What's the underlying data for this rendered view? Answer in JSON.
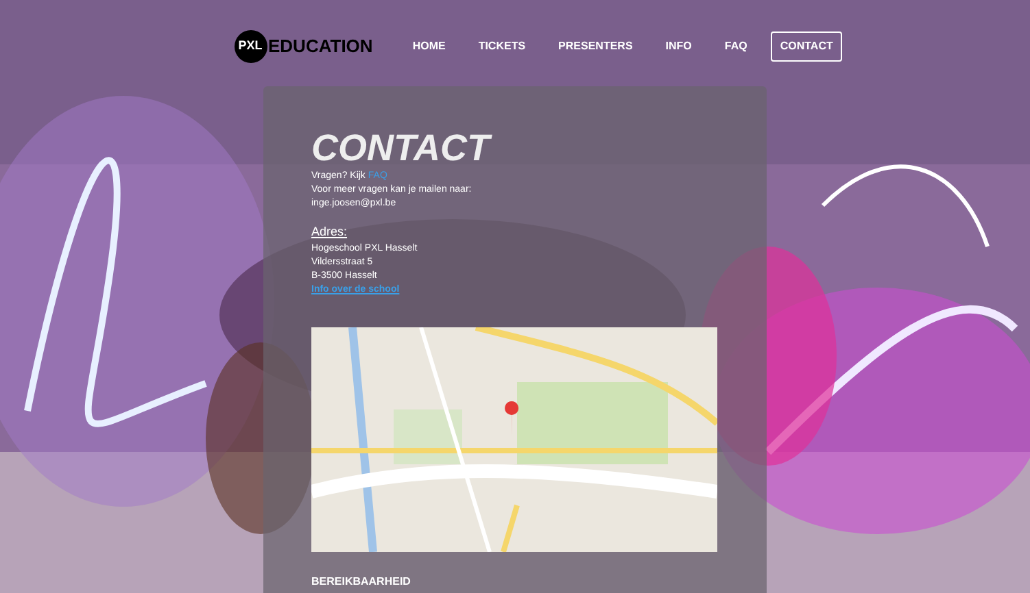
{
  "logo": {
    "badge": "PXL",
    "name": "EDUCATION"
  },
  "nav": [
    {
      "label": "HOME",
      "selected": false
    },
    {
      "label": "TICKETS",
      "selected": false
    },
    {
      "label": "PRESENTERS",
      "selected": false
    },
    {
      "label": "INFO",
      "selected": false
    },
    {
      "label": "FAQ",
      "selected": false
    },
    {
      "label": "CONTACT",
      "selected": true
    }
  ],
  "contact": {
    "title": "CONTACT",
    "question": "Vragen? Kijk",
    "faq_link": "FAQ",
    "mail_text": "Voor meer vragen kan je mailen naar:",
    "email": "inge.joosen@pxl.be",
    "address_heading": "Adres:",
    "address_lines": [
      "Hogeschool PXL Hasselt",
      "Vildersstraat 5",
      "B-3500 Hasselt"
    ],
    "school_link": "Info over de school"
  },
  "section_heading": "BEREIKBAARHEID"
}
